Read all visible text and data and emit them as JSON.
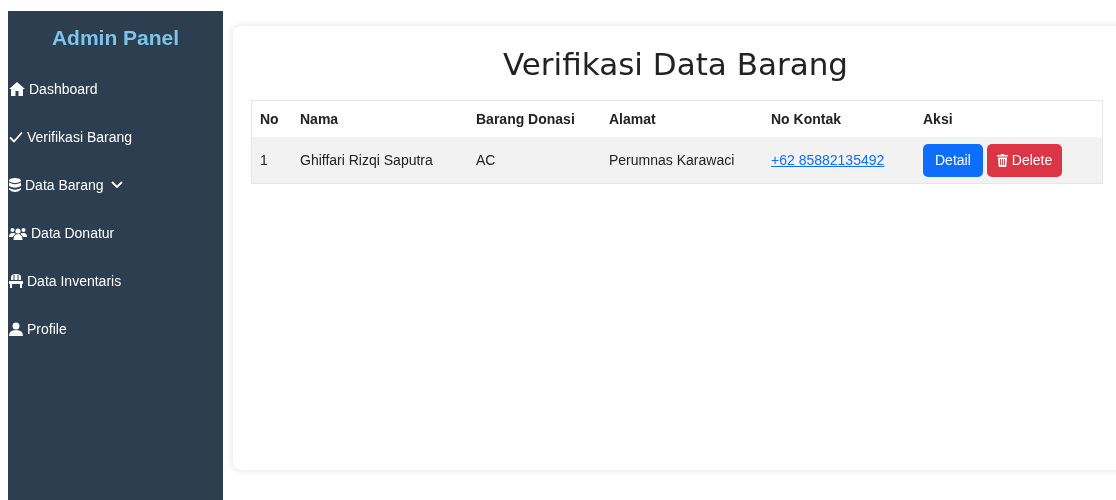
{
  "sidebar": {
    "title": "Admin Panel",
    "items": [
      {
        "label": "Dashboard",
        "has_submenu": false
      },
      {
        "label": "Verifikasi Barang",
        "has_submenu": false
      },
      {
        "label": "Data Barang",
        "has_submenu": true
      },
      {
        "label": "Data Donatur",
        "has_submenu": false
      },
      {
        "label": "Data Inventaris",
        "has_submenu": false
      },
      {
        "label": "Profile",
        "has_submenu": false
      }
    ]
  },
  "page_title": "Verifikasi Data Barang",
  "table": {
    "columns": [
      "No",
      "Nama",
      "Barang Donasi",
      "Alamat",
      "No Kontak",
      "Aksi"
    ],
    "rows": [
      {
        "no": "1",
        "nama": "Ghiffari Rizqi Saputra",
        "barang_donasi": "AC",
        "alamat": "Perumnas Karawaci",
        "no_kontak": "+62 85882135492",
        "actions": [
          {
            "label": "Detail",
            "kind": "primary"
          },
          {
            "label": "Delete",
            "kind": "danger"
          }
        ]
      }
    ]
  }
}
